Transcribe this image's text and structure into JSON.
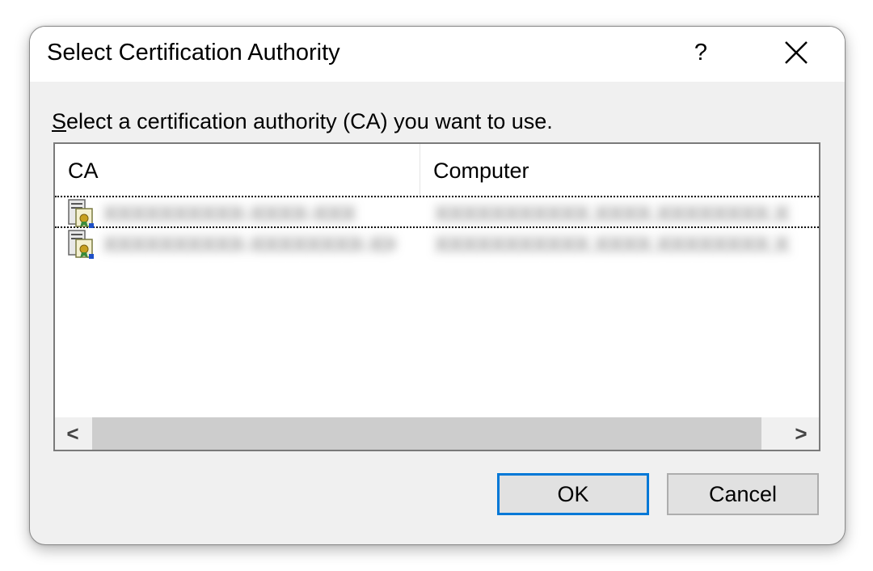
{
  "dialog": {
    "title": "Select Certification Authority",
    "help_label": "?",
    "close_icon": "close-icon"
  },
  "instruction": {
    "accelerator": "S",
    "rest": "elect a certification authority (CA) you want to use."
  },
  "list": {
    "columns": [
      "CA",
      "Computer"
    ],
    "rows": [
      {
        "ca": "XXXXXXXXXX-XXXX-XXX",
        "computer": "XXXXXXXXXXX.XXXX.XXXXXXXX.XXX",
        "icon": "certificate-server-icon"
      },
      {
        "ca": "XXXXXXXXXX-XXXXXXXX-XXX",
        "computer": "XXXXXXXXXXX.XXXX.XXXXXXXX.XXX",
        "icon": "certificate-server-icon"
      }
    ]
  },
  "scrollbar": {
    "left_arrow": "<",
    "right_arrow": ">"
  },
  "buttons": {
    "ok": "OK",
    "cancel": "Cancel"
  },
  "colors": {
    "dialog_bg": "#f0f0f0",
    "titlebar_bg": "#ffffff",
    "default_button_border": "#0078d7",
    "scroll_thumb": "#cdcdcd"
  }
}
